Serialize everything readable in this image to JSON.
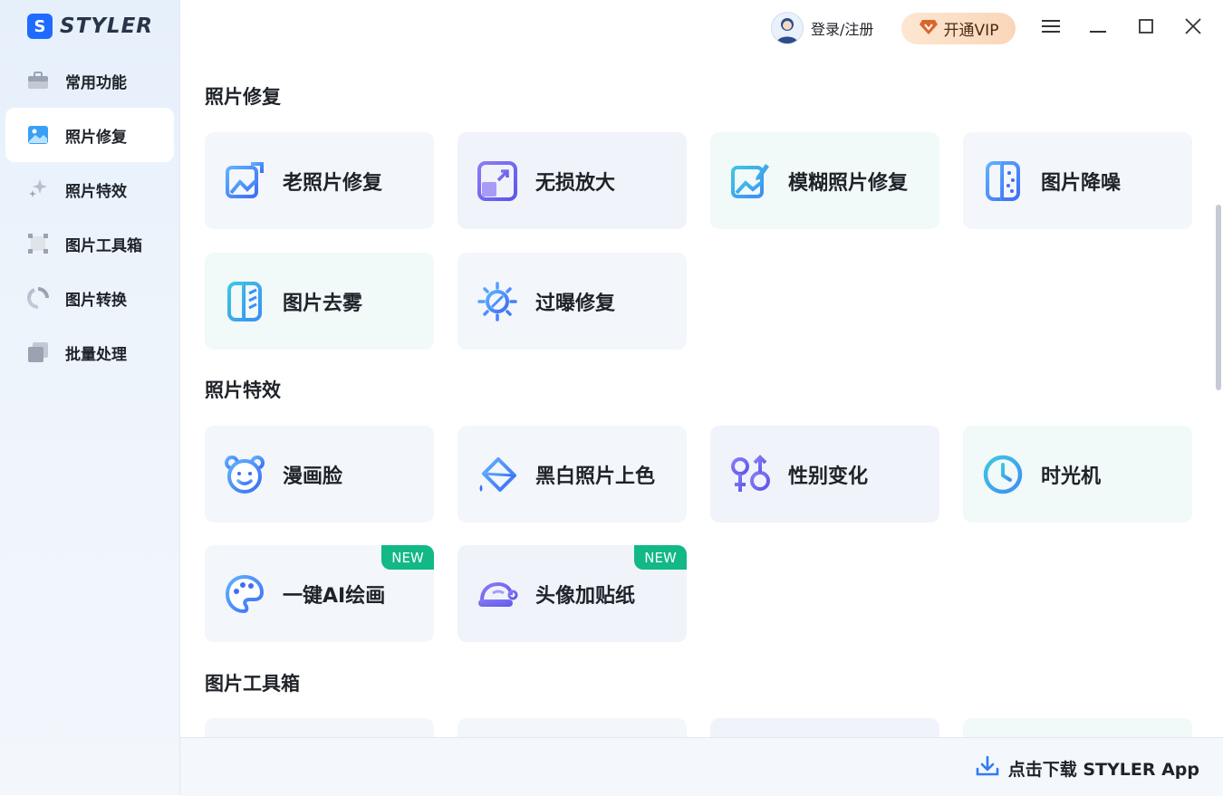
{
  "app": {
    "logo_letter": "S",
    "logo_text": "STYLER"
  },
  "sidebar": {
    "items": [
      {
        "label": "常用功能",
        "icon": "toolbox-icon",
        "active": false
      },
      {
        "label": "照片修复",
        "icon": "photo-icon",
        "active": true
      },
      {
        "label": "照片特效",
        "icon": "sparkle-icon",
        "active": false
      },
      {
        "label": "图片工具箱",
        "icon": "crop-frame-icon",
        "active": false
      },
      {
        "label": "图片转换",
        "icon": "convert-icon",
        "active": false
      },
      {
        "label": "批量处理",
        "icon": "stack-icon",
        "active": false
      }
    ]
  },
  "titlebar": {
    "login_label": "登录/注册",
    "vip_label": "开通VIP"
  },
  "sections": [
    {
      "title": "照片修复",
      "cards": [
        {
          "label": "老照片修复",
          "icon": "image-repair-icon"
        },
        {
          "label": "无损放大",
          "icon": "enlarge-icon"
        },
        {
          "label": "模糊照片修复",
          "icon": "image-edit-icon"
        },
        {
          "label": "图片降噪",
          "icon": "denoise-icon"
        },
        {
          "label": "图片去雾",
          "icon": "dehaze-icon"
        },
        {
          "label": "过曝修复",
          "icon": "sun-icon"
        }
      ]
    },
    {
      "title": "照片特效",
      "cards": [
        {
          "label": "漫画脸",
          "icon": "bear-face-icon"
        },
        {
          "label": "黑白照片上色",
          "icon": "paint-bucket-icon"
        },
        {
          "label": "性别变化",
          "icon": "gender-icon"
        },
        {
          "label": "时光机",
          "icon": "clock-icon"
        },
        {
          "label": "一键AI绘画",
          "icon": "palette-icon",
          "badge": "NEW"
        },
        {
          "label": "头像加贴纸",
          "icon": "hat-sticker-icon",
          "badge": "NEW"
        }
      ]
    },
    {
      "title": "图片工具箱",
      "cards": []
    }
  ],
  "footer": {
    "download_label": "点击下载 STYLER App"
  },
  "colors": {
    "accent": "#1f6bff",
    "badge_new": "#12b886",
    "vip_bg": "#fde7d2"
  }
}
